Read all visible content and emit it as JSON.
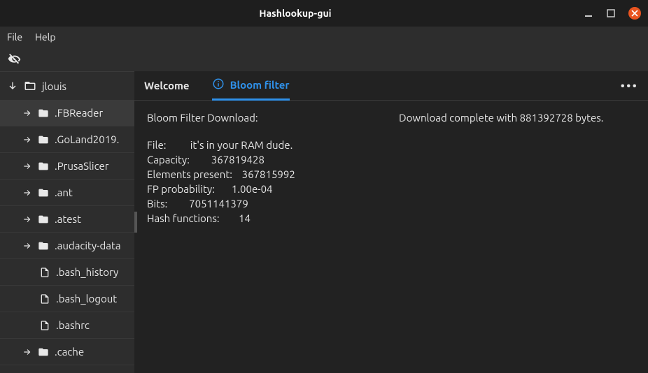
{
  "window": {
    "title": "Hashlookup-gui"
  },
  "menubar": {
    "file": "File",
    "help": "Help"
  },
  "sidebar": {
    "root": "jlouis",
    "items": [
      {
        "type": "folder",
        "label": ".FBReader",
        "selected": true
      },
      {
        "type": "folder",
        "label": ".GoLand2019."
      },
      {
        "type": "folder",
        "label": ".PrusaSlicer"
      },
      {
        "type": "folder",
        "label": ".ant"
      },
      {
        "type": "folder",
        "label": ".atest"
      },
      {
        "type": "folder",
        "label": ".audacity-data"
      },
      {
        "type": "file",
        "label": ".bash_history"
      },
      {
        "type": "file",
        "label": ".bash_logout"
      },
      {
        "type": "file",
        "label": ".bashrc"
      },
      {
        "type": "folder",
        "label": ".cache"
      }
    ]
  },
  "tabs": {
    "welcome": "Welcome",
    "bloom": "Bloom filter"
  },
  "bloom": {
    "download_label": "Bloom Filter Download:",
    "download_status": "Download complete with 881392728 bytes.",
    "stats_text": "File:          it's in your RAM dude.\nCapacity:         367819428\nElements present:    367815992\nFP probability:       1.00e-04\nBits:         7051141379\nHash functions:        14"
  }
}
